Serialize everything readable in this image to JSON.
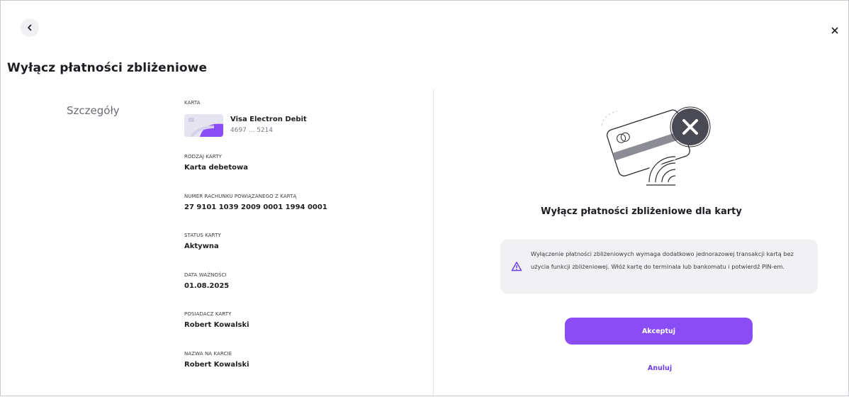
{
  "header": {
    "title": "Wyłącz płatności zbliżeniowe",
    "back_icon": "chevron-left-icon",
    "close_icon": "close-icon"
  },
  "details": {
    "section_label": "Szczegóły",
    "card": {
      "label": "KARTA",
      "name": "Visa Electron Debit",
      "number": "4697 ... 5214"
    },
    "fields": [
      {
        "label": "RODZAJ KARTY",
        "value": "Karta debetowa"
      },
      {
        "label": "NUMER RACHUNKU POWIĄZANEGO Z KARTĄ",
        "value": "27 9101 1039 2009 0001 1994 0001"
      },
      {
        "label": "STATUS KARTY",
        "value": "Aktywna"
      },
      {
        "label": "DATA WAŻNOŚCI",
        "value": "01.08.2025"
      },
      {
        "label": "POSIADACZ KARTY",
        "value": "Robert Kowalski"
      },
      {
        "label": "NAZWA NA KARCIE",
        "value": "Robert Kowalski"
      }
    ]
  },
  "panel": {
    "title": "Wyłącz płatności zbliżeniowe dla karty",
    "info_icon": "warning-icon",
    "info_text": "Wyłączenie płatności zbliżeniowych wymaga dodatkowo jednorazowej transakcji kartą bez użycia funkcji zbliżeniowej. Włóż kartę do terminala lub bankomatu i potwierdź PIN-em.",
    "accept_label": "Akceptuj",
    "cancel_label": "Anuluj"
  },
  "colors": {
    "accent": "#8a4df5",
    "link": "#6e3fe8",
    "info_bg": "#f1f1f4"
  }
}
